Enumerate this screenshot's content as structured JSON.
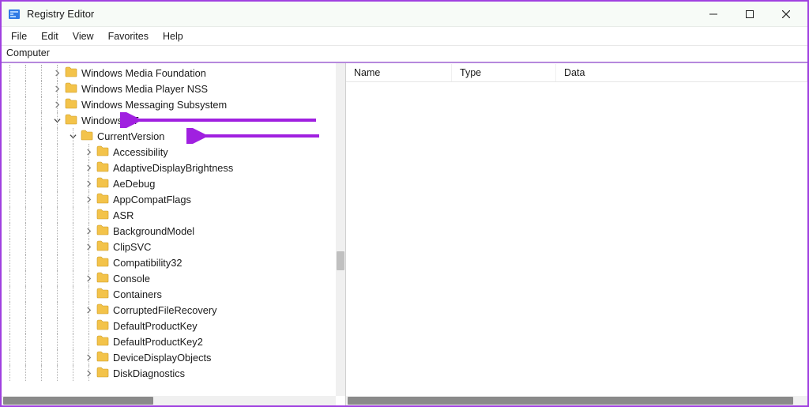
{
  "window": {
    "title": "Registry Editor"
  },
  "menu": {
    "file": "File",
    "edit": "Edit",
    "view": "View",
    "favorites": "Favorites",
    "help": "Help"
  },
  "address": "Computer",
  "columns": {
    "name": "Name",
    "type": "Type",
    "data": "Data"
  },
  "tree": {
    "n0": "Windows Media Foundation",
    "n1": "Windows Media Player NSS",
    "n2": "Windows Messaging Subsystem",
    "n3": "Windows NT",
    "n4": "CurrentVersion",
    "n5": "Accessibility",
    "n6": "AdaptiveDisplayBrightness",
    "n7": "AeDebug",
    "n8": "AppCompatFlags",
    "n9": "ASR",
    "n10": "BackgroundModel",
    "n11": "ClipSVC",
    "n12": "Compatibility32",
    "n13": "Console",
    "n14": "Containers",
    "n15": "CorruptedFileRecovery",
    "n16": "DefaultProductKey",
    "n17": "DefaultProductKey2",
    "n18": "DeviceDisplayObjects",
    "n19": "DiskDiagnostics"
  },
  "icons": {
    "regedit": "regedit"
  }
}
